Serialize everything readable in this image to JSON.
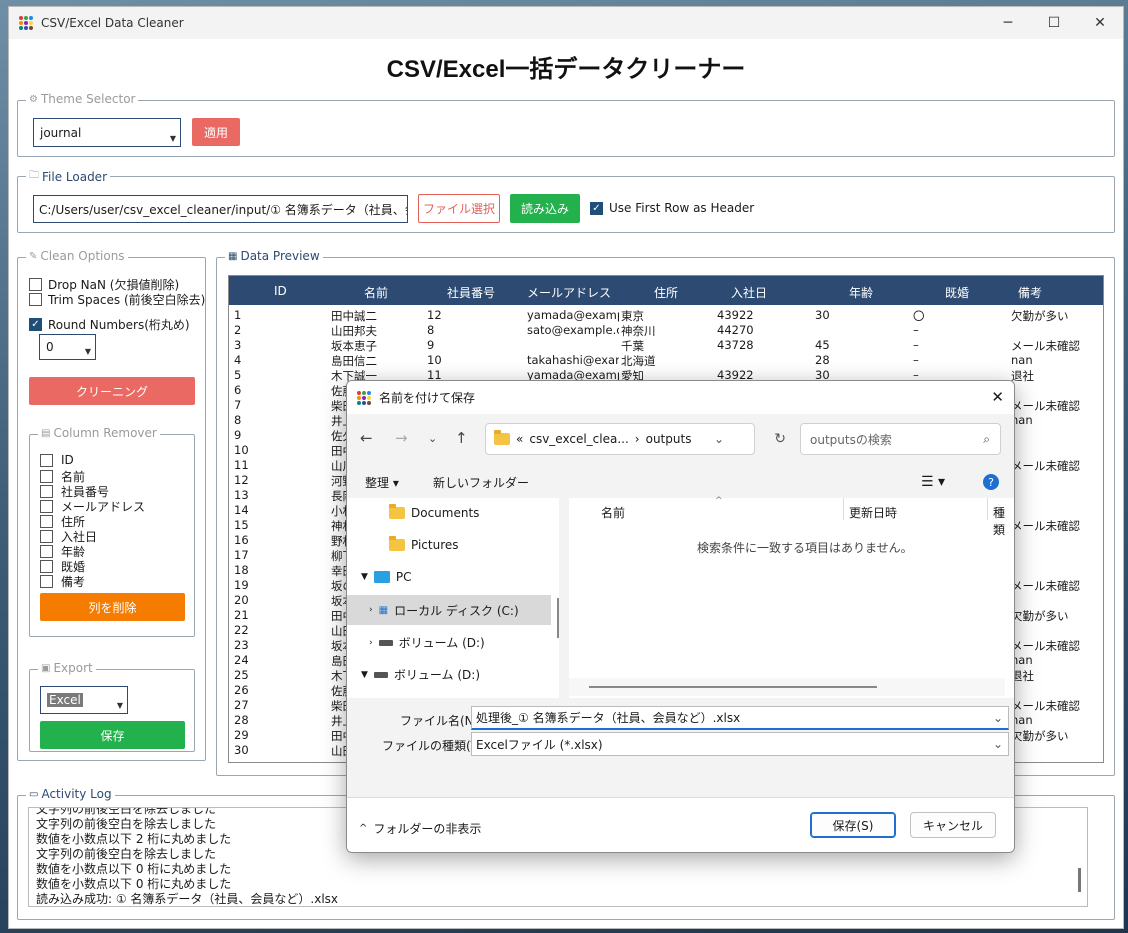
{
  "window": {
    "title": "CSV/Excel Data Cleaner",
    "minimize": "─",
    "maximize": "☐",
    "close": "✕"
  },
  "app_title": "CSV/Excel一括データクリーナー",
  "theme": {
    "legend": "Theme Selector",
    "selected": "journal",
    "apply_label": "適用"
  },
  "file_loader": {
    "legend": "File Loader",
    "path": "C:/Users/user/csv_excel_cleaner/input/① 名簿系データ（社員、会員な",
    "select_label": "ファイル選択",
    "load_label": "読み込み",
    "header_label": "Use First Row as Header",
    "header_checked": true
  },
  "clean_options": {
    "legend": "Clean Options",
    "drop_nan": "Drop NaN (欠損値削除)",
    "trim_spaces": "Trim Spaces (前後空白除去)",
    "round_numbers": "Round Numbers(桁丸め)",
    "round_value": "0",
    "clean_label": "クリーニング"
  },
  "column_remover": {
    "legend": "Column Remover",
    "columns": [
      "ID",
      "名前",
      "社員番号",
      "メールアドレス",
      "住所",
      "入社日",
      "年齢",
      "既婚",
      "備考"
    ],
    "remove_label": "列を削除"
  },
  "export": {
    "legend": "Export",
    "format": "Excel",
    "save_label": "保存"
  },
  "data_preview": {
    "legend": "Data Preview",
    "headers": [
      "ID",
      "名前",
      "社員番号",
      "メールアドレス",
      "住所",
      "入社日",
      "年齢",
      "既婚",
      "備考"
    ],
    "rows": [
      [
        "1",
        "田中誠二",
        "12",
        "yamada@examp",
        "東京",
        "43922",
        "30",
        "〇",
        "欠勤が多い"
      ],
      [
        "2",
        "山田邦夫",
        "8",
        "sato@example.c",
        "神奈川",
        "44270",
        "",
        "–",
        ""
      ],
      [
        "3",
        "坂本恵子",
        "9",
        "",
        "千葉",
        "43728",
        "45",
        "–",
        "メール未確認"
      ],
      [
        "4",
        "島田信二",
        "10",
        "takahashi@exan",
        "北海道",
        "",
        "28",
        "–",
        "nan"
      ],
      [
        "5",
        "木下誠一",
        "11",
        "yamada@examp",
        "愛知",
        "43922",
        "30",
        "–",
        "退社"
      ],
      [
        "6",
        "佐藤",
        "",
        "",
        "",
        "",
        "",
        "",
        ""
      ],
      [
        "7",
        "柴田",
        "",
        "",
        "",
        "",
        "",
        "",
        "メール未確認"
      ],
      [
        "8",
        "井上",
        "",
        "",
        "",
        "",
        "",
        "",
        "nan"
      ],
      [
        "9",
        "佐久",
        "",
        "",
        "",
        "",
        "",
        "",
        ""
      ],
      [
        "10",
        "田中",
        "",
        "",
        "",
        "",
        "",
        "",
        ""
      ],
      [
        "11",
        "山川",
        "",
        "",
        "",
        "",
        "",
        "",
        "メール未確認"
      ],
      [
        "12",
        "河野",
        "",
        "",
        "",
        "",
        "",
        "",
        ""
      ],
      [
        "13",
        "長岡",
        "",
        "",
        "",
        "",
        "",
        "",
        ""
      ],
      [
        "14",
        "小林",
        "",
        "",
        "",
        "",
        "",
        "",
        ""
      ],
      [
        "15",
        "神林",
        "",
        "",
        "",
        "",
        "",
        "",
        "メール未確認"
      ],
      [
        "16",
        "野村",
        "",
        "",
        "",
        "",
        "",
        "",
        ""
      ],
      [
        "17",
        "柳下",
        "",
        "",
        "",
        "",
        "",
        "",
        ""
      ],
      [
        "18",
        "幸田",
        "",
        "",
        "",
        "",
        "",
        "",
        ""
      ],
      [
        "19",
        "坂の",
        "",
        "",
        "",
        "",
        "",
        "",
        "メール未確認"
      ],
      [
        "20",
        "坂本",
        "",
        "",
        "",
        "",
        "",
        "",
        ""
      ],
      [
        "21",
        "田中",
        "",
        "",
        "",
        "",
        "",
        "",
        "欠勤が多い"
      ],
      [
        "22",
        "山田",
        "",
        "",
        "",
        "",
        "",
        "",
        ""
      ],
      [
        "23",
        "坂本",
        "",
        "",
        "",
        "",
        "",
        "",
        "メール未確認"
      ],
      [
        "24",
        "島田",
        "",
        "",
        "",
        "",
        "",
        "",
        "nan"
      ],
      [
        "25",
        "木下",
        "",
        "",
        "",
        "",
        "",
        "",
        "退社"
      ],
      [
        "26",
        "佐藤",
        "",
        "",
        "",
        "",
        "",
        "",
        ""
      ],
      [
        "27",
        "柴田",
        "",
        "",
        "",
        "",
        "",
        "",
        "メール未確認"
      ],
      [
        "28",
        "井上",
        "",
        "",
        "",
        "",
        "",
        "",
        "nan"
      ],
      [
        "29",
        "田中",
        "",
        "",
        "",
        "",
        "",
        "",
        "欠勤が多い"
      ],
      [
        "30",
        "山田",
        "",
        "",
        "",
        "",
        "",
        "",
        ""
      ]
    ]
  },
  "activity_log": {
    "legend": "Activity Log",
    "lines": [
      "文字列の前後空白を除去しました",
      "文字列の前後空白を除去しました",
      "数値を小数点以下 2 桁に丸めました",
      "文字列の前後空白を除去しました",
      "数値を小数点以下 0 桁に丸めました",
      "数値を小数点以下 0 桁に丸めました",
      "読み込み成功: ① 名簿系データ（社員、会員など）.xlsx"
    ]
  },
  "save_dialog": {
    "title": "名前を付けて保存",
    "breadcrumb": [
      "«",
      "csv_excel_clea...",
      "›",
      "outputs"
    ],
    "search_placeholder": "outputsの検索",
    "organize_label": "整理 ▾",
    "new_folder_label": "新しいフォルダー",
    "tree": [
      "Documents",
      "Pictures",
      "PC",
      "ローカル ディスク (C:)",
      "ボリューム (D:)",
      "ボリューム (D:)"
    ],
    "col_name": "名前",
    "col_modified": "更新日時",
    "col_type": "種類",
    "empty_message": "検索条件に一致する項目はありません。",
    "filename_label": "ファイル名(N):",
    "filename_value": "処理後_① 名簿系データ（社員、会員など）.xlsx",
    "filetype_label": "ファイルの種類(T):",
    "filetype_value": "Excelファイル (*.xlsx)",
    "hide_folders_label": "フォルダーの非表示",
    "save_label": "保存(S)",
    "cancel_label": "キャンセル"
  }
}
